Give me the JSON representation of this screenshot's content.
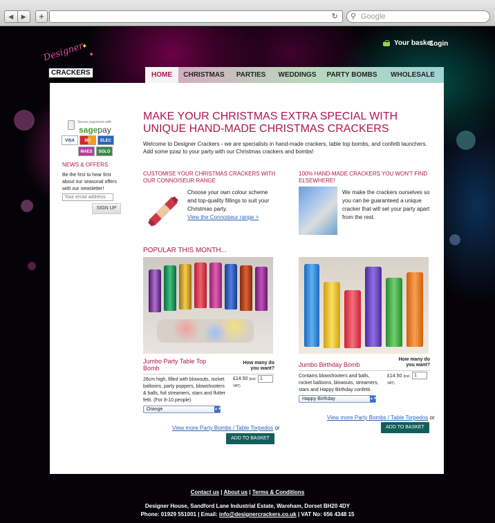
{
  "browser": {
    "back": "◀",
    "forward": "▶",
    "new_tab": "+",
    "reload": "↻",
    "search_placeholder": "Google"
  },
  "header": {
    "basket": "Your basket",
    "login": "Login"
  },
  "logo": {
    "script": "Designer",
    "name": "CRACKERS"
  },
  "nav": [
    {
      "label": "HOME",
      "active": true
    },
    {
      "label": "CHRISTMAS"
    },
    {
      "label": "PARTIES"
    },
    {
      "label": "WEDDINGS"
    },
    {
      "label": "PARTY BOMBS"
    },
    {
      "label": "WHOLESALE"
    }
  ],
  "sidebar": {
    "secure_text": "Secure payments with",
    "sagepay_sage": "sage",
    "sagepay_pay": "pay",
    "cards": [
      "VISA",
      "MC",
      "ELEC",
      "MAES",
      "SOLO"
    ],
    "news_title": "NEWS & OFFERS",
    "news_text": "Be the first to hear first about our seasonal offers with our newsletter!",
    "email_placeholder": "Your email address",
    "signup": "SIGN UP"
  },
  "main": {
    "headline": "MAKE YOUR CHRISTMAS EXTRA SPECIAL WITH UNIQUE HAND-MADE CHRISTMAS CRACKERS",
    "intro": "Welcome to Designer Crackers - we are specialists in hand-made crackers, table top bombs, and confetti launchers.  Add some pzaz to your party with our Christmas crackers and bombs!",
    "feature1": {
      "title": "CUSTOMISE YOUR CHRISTMAS CRACKERS WITH OUR CONNOISEUR RANGE",
      "text": "Choose your own colour scheme and top-quality fillings to suit your Christmas party.",
      "link": "View the Connoiseur range >"
    },
    "feature2": {
      "title": "100% HAND-MADE CRACKERS YOU WON'T FIND ELSEWHERE!",
      "text": "We make the crackers ourselves so you can be guaranteed a unique cracker that will set your party apart from the rest."
    },
    "popular_title": "POPULAR THIS MONTH...",
    "how_many": "How many do you want?",
    "products": [
      {
        "name": "Jumbo Party Table Top Bomb",
        "desc": "26cm high, filled with blowouts, rocket balloons, party poppers, blowshooters & balls, foil streamers, stars and flutter fetti. (For 8-10 people)",
        "price": "£14.50",
        "price_note": "(incl. VAT)",
        "qty": "1",
        "option": "Orange"
      },
      {
        "name": "Jumbo Birthday Bomb",
        "desc": "Contains blowshooters and balls, rocket balloons, blowouts, streamers, stars and Happy Birthday confetti.",
        "price": "£14.50",
        "price_note": "(incl. VAT)",
        "qty": "1",
        "option": "Happy Birthday"
      }
    ],
    "more_link": "View more Party Bombs / Table Torpedos",
    "more_or": "or",
    "add_to_basket": "ADD TO BASKET"
  },
  "footer": {
    "contact": "Contact us",
    "about": "About us",
    "terms": "Terms & Conditions",
    "sep": "|",
    "address": "Designer House, Sandford Lane Industrial Estate, Wareham, Dorset BH20 4DY",
    "phone": "Phone: 01929 551001 | Email:",
    "email": "info@designercrackers.co.uk",
    "vat": "| VAT No: 656 4348 15"
  },
  "colors": {
    "accent": "#b0144f",
    "link": "#2c62b5",
    "button": "#125e5a"
  }
}
